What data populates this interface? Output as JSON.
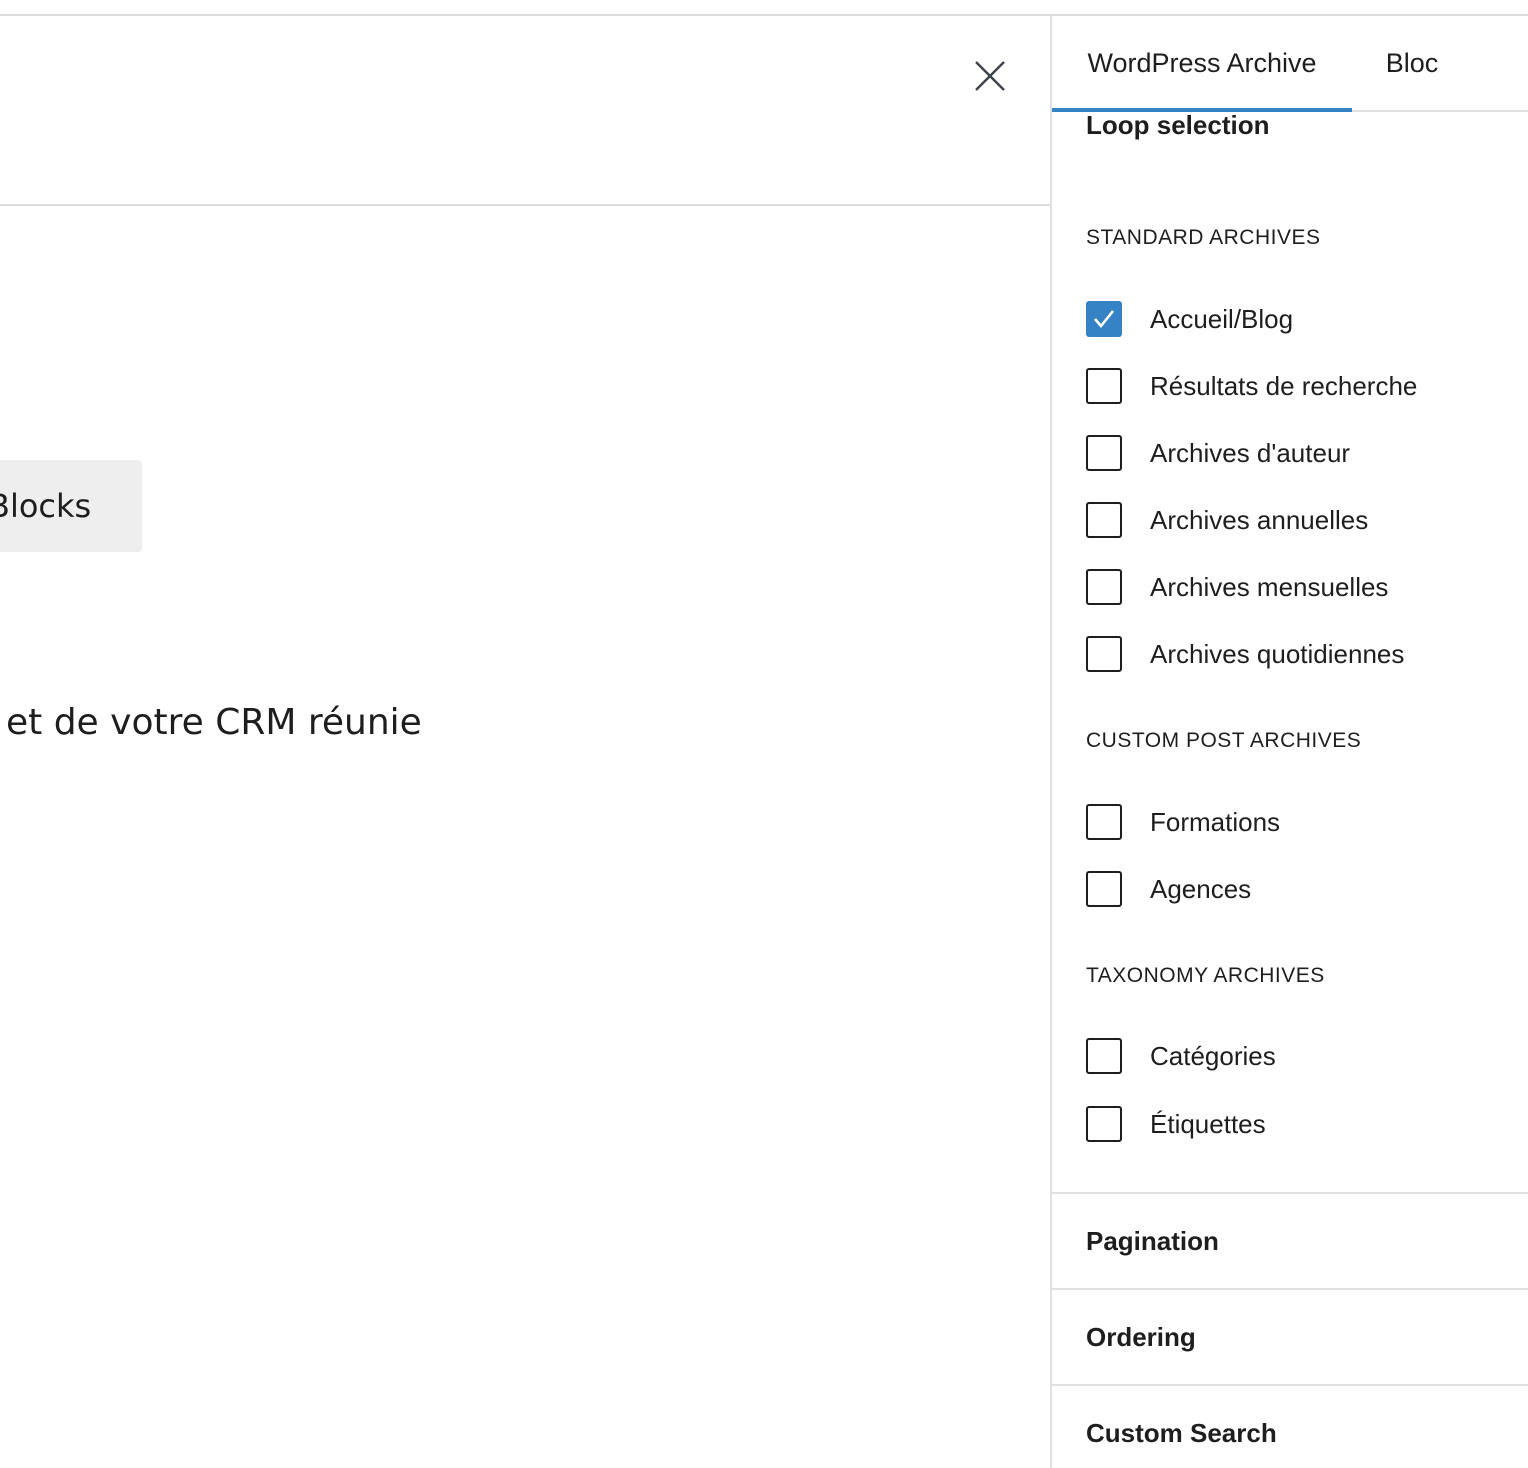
{
  "editor": {
    "close_label": "Close",
    "blocks_button_label": "Blocks",
    "content_text": "et de votre CRM réunie"
  },
  "sidebar": {
    "tabs": [
      {
        "label": "WordPress Archive",
        "active": true
      },
      {
        "label": "Bloc",
        "active": false
      }
    ],
    "loop_selection_title": "Loop selection",
    "standard_archives": {
      "heading": "STANDARD ARCHIVES",
      "items": [
        {
          "label": "Accueil/Blog",
          "checked": true
        },
        {
          "label": "Résultats de recherche",
          "checked": false
        },
        {
          "label": "Archives d'auteur",
          "checked": false
        },
        {
          "label": "Archives annuelles",
          "checked": false
        },
        {
          "label": "Archives mensuelles",
          "checked": false
        },
        {
          "label": "Archives quotidiennes",
          "checked": false
        }
      ]
    },
    "custom_post_archives": {
      "heading": "CUSTOM POST ARCHIVES",
      "items": [
        {
          "label": "Formations",
          "checked": false
        },
        {
          "label": "Agences",
          "checked": false
        }
      ]
    },
    "taxonomy_archives": {
      "heading": "TAXONOMY ARCHIVES",
      "items": [
        {
          "label": "Catégories",
          "checked": false
        },
        {
          "label": "Étiquettes",
          "checked": false
        }
      ]
    },
    "panels": [
      {
        "label": "Pagination"
      },
      {
        "label": "Ordering"
      },
      {
        "label": "Custom Search"
      }
    ]
  },
  "colors": {
    "accent": "#3582c4",
    "text": "#1e1e1e",
    "border": "#e0e0e0",
    "button_bg": "#eeeeee"
  }
}
